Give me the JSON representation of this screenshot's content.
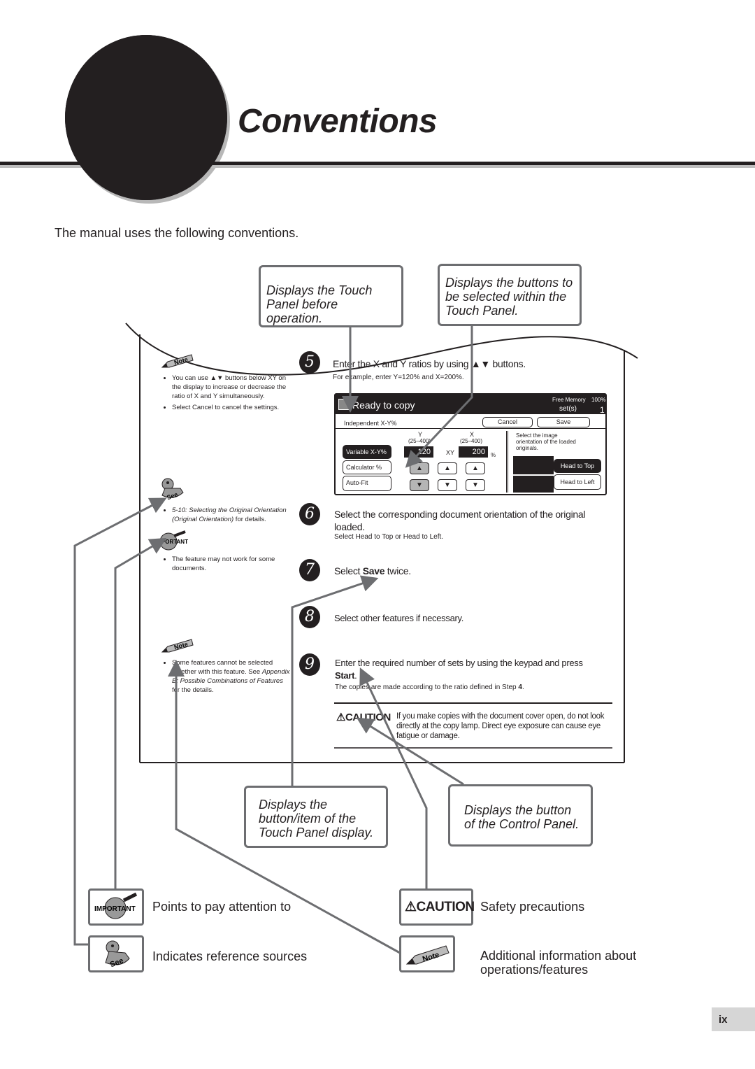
{
  "header": {
    "title": "Conventions",
    "intro": "The manual uses the following conventions."
  },
  "callouts": {
    "touch_panel_before": "Displays the Touch Panel before operation.",
    "buttons_within": "Displays the buttons to be selected within the Touch Panel.",
    "button_item": "Displays the button/item of the Touch Panel display.",
    "control_panel_button": "Displays the button of the Control Panel."
  },
  "sample_page": {
    "side_notes": {
      "note1_badge": "Note",
      "note1_items": [
        "You can use ▲▼ buttons below XY on the display to increase or decrease the ratio of X and Y simultaneously.",
        "Select Cancel to cancel the settings."
      ],
      "see_badge": "See",
      "see_item_italic": "5-10: Selecting the Original Orientation (Original Orientation)",
      "see_item_rest": " for details.",
      "important_badge": "IMPORTANT",
      "important_item": "The feature may not work for some documents.",
      "note2_badge": "Note",
      "note2_item_pre": "Some features cannot be selected together with this feature. See ",
      "note2_item_italic": "Appendix B: Possible Combinations of Features",
      "note2_item_post": " for the details."
    },
    "steps": [
      {
        "num": "5",
        "main": "Enter the X and Y ratios by using ▲▼ buttons.",
        "sub": "For example, enter Y=120% and X=200%."
      },
      {
        "num": "6",
        "main": "Select the corresponding document orientation of the original loaded.",
        "sub": "Select Head to Top or Head to Left."
      },
      {
        "num": "7",
        "main_pre": "Select ",
        "main_bold": "Save",
        "main_post": " twice."
      },
      {
        "num": "8",
        "main": "Select other features if necessary."
      },
      {
        "num": "9",
        "main": "Enter the required number of sets by using the keypad and press",
        "main_bold": "Start",
        "sub_pre": "The copies are made according to the ratio defined in Step ",
        "sub_bold": "4",
        "sub_post": "."
      }
    ],
    "caution": {
      "label": "CAUTION",
      "text": "If you make copies with the document cover open, do not look directly at the copy lamp.  Direct eye exposure can cause eye fatigue or damage."
    },
    "touch_panel": {
      "status": "Ready to copy",
      "free_memory_label": "Free Memory",
      "free_memory_value": "100%",
      "sets_label": "set(s)",
      "sets_value": "1",
      "feature_title": "Independent X-Y%",
      "cancel": "Cancel",
      "save": "Save",
      "y_label": "Y",
      "y_range": "(25–400)",
      "x_label": "X",
      "x_range": "(25–400)",
      "y_value": "120",
      "x_value": "200",
      "xy_label": "XY",
      "percent": "%",
      "modes": [
        "Variable X-Y%",
        "Calculator %",
        "Auto-Fit"
      ],
      "orientation_prompt": "Select the image orientation of the loaded originals.",
      "head_to_top": "Head to Top",
      "head_to_left": "Head to Left"
    }
  },
  "legend": [
    {
      "icon": "IMPORTANT",
      "text": "Points to pay attention to"
    },
    {
      "icon": "See",
      "text": "Indicates reference sources"
    },
    {
      "icon": "CAUTION",
      "text": "Safety precautions"
    },
    {
      "icon": "Note",
      "text": "Additional information about operations/features"
    }
  ],
  "page_number": "ix",
  "colors": {
    "ink": "#231f20",
    "arrow_grey": "#6d6e71",
    "rule_grey": "#bdbdbd",
    "page_tab": "#d6d6d6"
  }
}
